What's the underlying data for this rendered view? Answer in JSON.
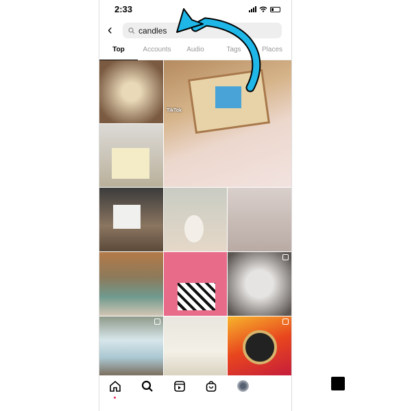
{
  "status": {
    "time": "2:33"
  },
  "search": {
    "query": "candles"
  },
  "tabs": [
    "Top",
    "Accounts",
    "Audio",
    "Tags",
    "Places"
  ],
  "active_tab": "Top",
  "tiles": [
    {
      "label": "TikTok"
    }
  ],
  "colors": {
    "arrow": "#1fb6e8",
    "notification_dot": "#f0245a"
  }
}
